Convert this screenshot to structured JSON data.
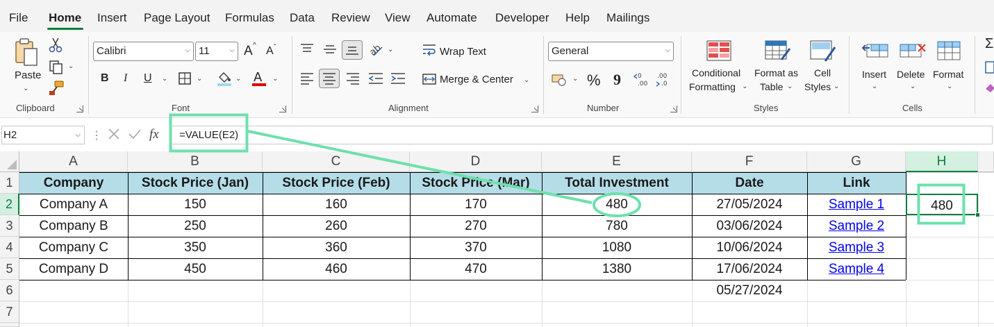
{
  "menu": {
    "tabs": [
      "File",
      "Home",
      "Insert",
      "Page Layout",
      "Formulas",
      "Data",
      "Review",
      "View",
      "Automate",
      "Developer",
      "Help",
      "Mailings"
    ],
    "active": "Home"
  },
  "ribbon": {
    "clipboard": {
      "paste": "Paste",
      "label": "Clipboard"
    },
    "font": {
      "name": "Calibri",
      "size": "11",
      "label": "Font",
      "bold": "B",
      "italic": "I",
      "underline": "U",
      "grow": "A",
      "shrink": "A"
    },
    "alignment": {
      "wrap": "Wrap Text",
      "merge": "Merge & Center",
      "label": "Alignment"
    },
    "number": {
      "format": "General",
      "percent": "%",
      "comma": "9",
      "label": "Number"
    },
    "styles": {
      "conditional_1": "Conditional",
      "conditional_2": "Formatting",
      "format_as_1": "Format as",
      "format_as_2": "Table",
      "cell_styles_1": "Cell",
      "cell_styles_2": "Styles",
      "label": "Styles"
    },
    "cells": {
      "insert": "Insert",
      "delete": "Delete",
      "format": "Format",
      "label": "Cells"
    }
  },
  "formula_bar": {
    "name_box": "H2",
    "formula": "=VALUE(E2)",
    "fx": "fx"
  },
  "sheet": {
    "columns": [
      "A",
      "B",
      "C",
      "D",
      "E",
      "F",
      "G",
      "H"
    ],
    "rows": [
      "1",
      "2",
      "3",
      "4",
      "5",
      "6",
      "7"
    ],
    "headers": [
      "Company",
      "Stock Price (Jan)",
      "Stock Price (Feb)",
      "Stock Price (Mar)",
      "Total Investment",
      "Date",
      "Link"
    ],
    "data": [
      [
        "Company A",
        "150",
        "160",
        "170",
        "480",
        "27/05/2024",
        "Sample 1"
      ],
      [
        "Company B",
        "250",
        "260",
        "270",
        "780",
        "03/06/2024",
        "Sample 2"
      ],
      [
        "Company C",
        "350",
        "360",
        "370",
        "1080",
        "10/06/2024",
        "Sample 3"
      ],
      [
        "Company D",
        "450",
        "460",
        "470",
        "1380",
        "17/06/2024",
        "Sample 4"
      ]
    ],
    "f6": "05/27/2024",
    "h2": "480"
  },
  "colors": {
    "accent_green": "#107c41",
    "annotation_green": "#6ee0ac",
    "header_fill": "#b4dde8",
    "link_blue": "#0000ee"
  },
  "icons": [
    "paste-icon",
    "cut-icon",
    "copy-icon",
    "format-painter-icon",
    "border-icon",
    "fill-color-icon",
    "font-color-icon",
    "wrap-text-icon",
    "merge-icon",
    "accounting-icon",
    "conditional-formatting-icon",
    "format-as-table-icon",
    "cell-styles-icon",
    "insert-cells-icon",
    "delete-cells-icon",
    "format-cells-icon",
    "cancel-icon",
    "enter-icon"
  ]
}
